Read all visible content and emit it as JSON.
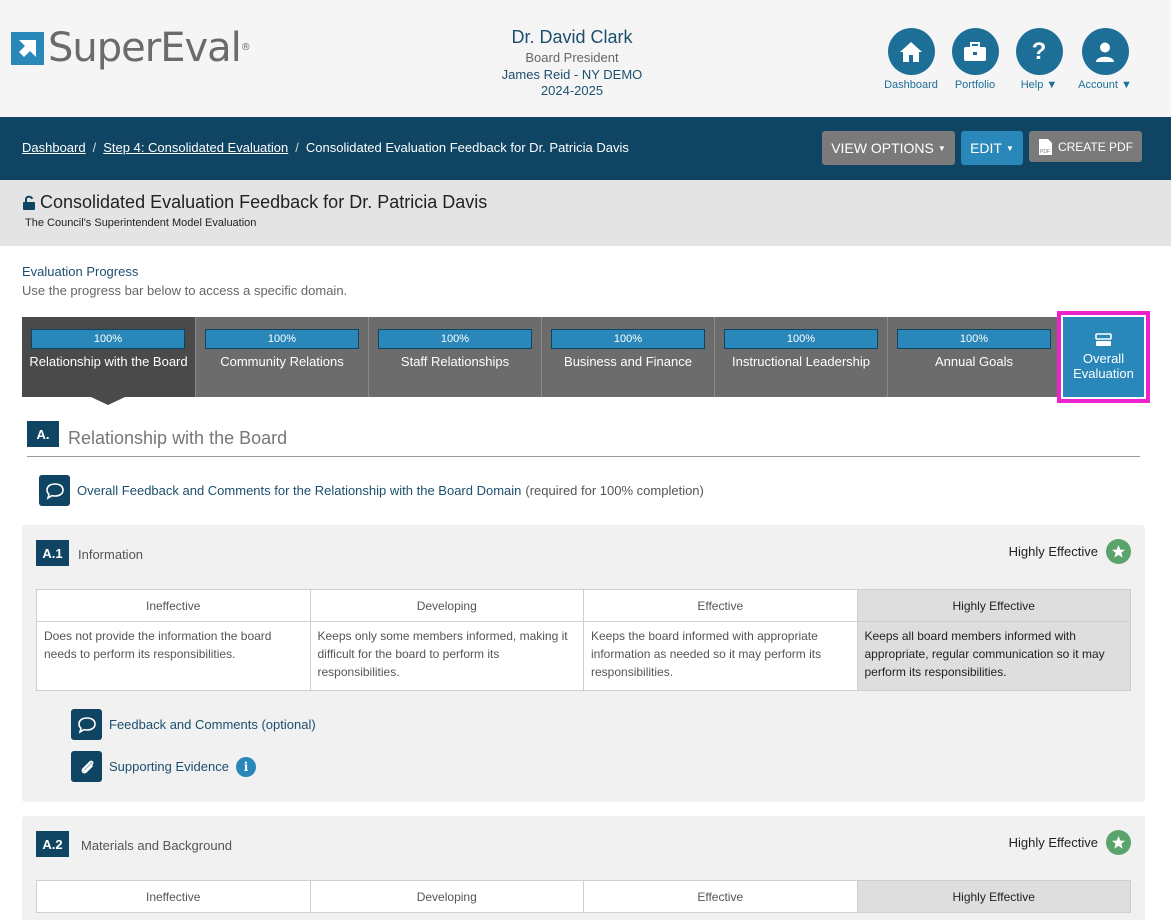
{
  "brand": {
    "name": "SuperEval",
    "mark": "®"
  },
  "user": {
    "name": "Dr. David Clark",
    "role": "Board President",
    "org": "James Reid - NY DEMO",
    "year": "2024-2025"
  },
  "nav": [
    {
      "label": "Dashboard",
      "icon": "home-icon"
    },
    {
      "label": "Portfolio",
      "icon": "briefcase-icon"
    },
    {
      "label": "Help",
      "icon": "question-icon"
    },
    {
      "label": "Account",
      "icon": "user-icon"
    }
  ],
  "breadcrumb": {
    "items": [
      "Dashboard",
      "Step 4: Consolidated Evaluation"
    ],
    "current": "Consolidated Evaluation Feedback for Dr. Patricia Davis",
    "sep": "/"
  },
  "toolbar": {
    "view_options": "VIEW OPTIONS",
    "edit": "EDIT",
    "create_pdf": "CREATE PDF"
  },
  "page": {
    "title": "Consolidated Evaluation Feedback for Dr. Patricia Davis",
    "subtitle": "The Council's Superintendent Model Evaluation"
  },
  "progress": {
    "title": "Evaluation Progress",
    "description": "Use the progress bar below to access a specific domain.",
    "tabs": [
      {
        "label": "Relationship with the Board",
        "percent": "100%",
        "active": true
      },
      {
        "label": "Community Relations",
        "percent": "100%"
      },
      {
        "label": "Staff Relationships",
        "percent": "100%"
      },
      {
        "label": "Business and Finance",
        "percent": "100%"
      },
      {
        "label": "Instructional Leadership",
        "percent": "100%"
      },
      {
        "label": "Annual Goals",
        "percent": "100%"
      }
    ],
    "overall": {
      "label": "Overall Evaluation"
    }
  },
  "domain": {
    "badge": "A.",
    "title": "Relationship with the Board",
    "feedback_link": "Overall Feedback and Comments for the Relationship with the Board Domain",
    "feedback_note": "(required for 100% completion)"
  },
  "rubric_headers": [
    "Ineffective",
    "Developing",
    "Effective",
    "Highly Effective"
  ],
  "indicators": [
    {
      "badge": "A.1",
      "title": "Information",
      "rating": "Highly Effective",
      "cells": [
        "Does not provide the information the board needs to perform its responsibilities.",
        "Keeps only some members informed, making it difficult for the board to perform its responsibilities.",
        "Keeps the board informed with appropriate information as needed so it may perform its responsibilities.",
        "Keeps all board members informed with appropriate, regular communication so it may perform its responsibilities."
      ],
      "feedback_link": "Feedback and Comments (optional)",
      "evidence_link": "Supporting Evidence"
    },
    {
      "badge": "A.2",
      "title": "Materials and Background",
      "rating": "Highly Effective"
    }
  ],
  "colors": {
    "navy": "#0f4462",
    "accent": "#2a87b9",
    "highlight": "#ee22cc",
    "star": "#5aa36b"
  }
}
